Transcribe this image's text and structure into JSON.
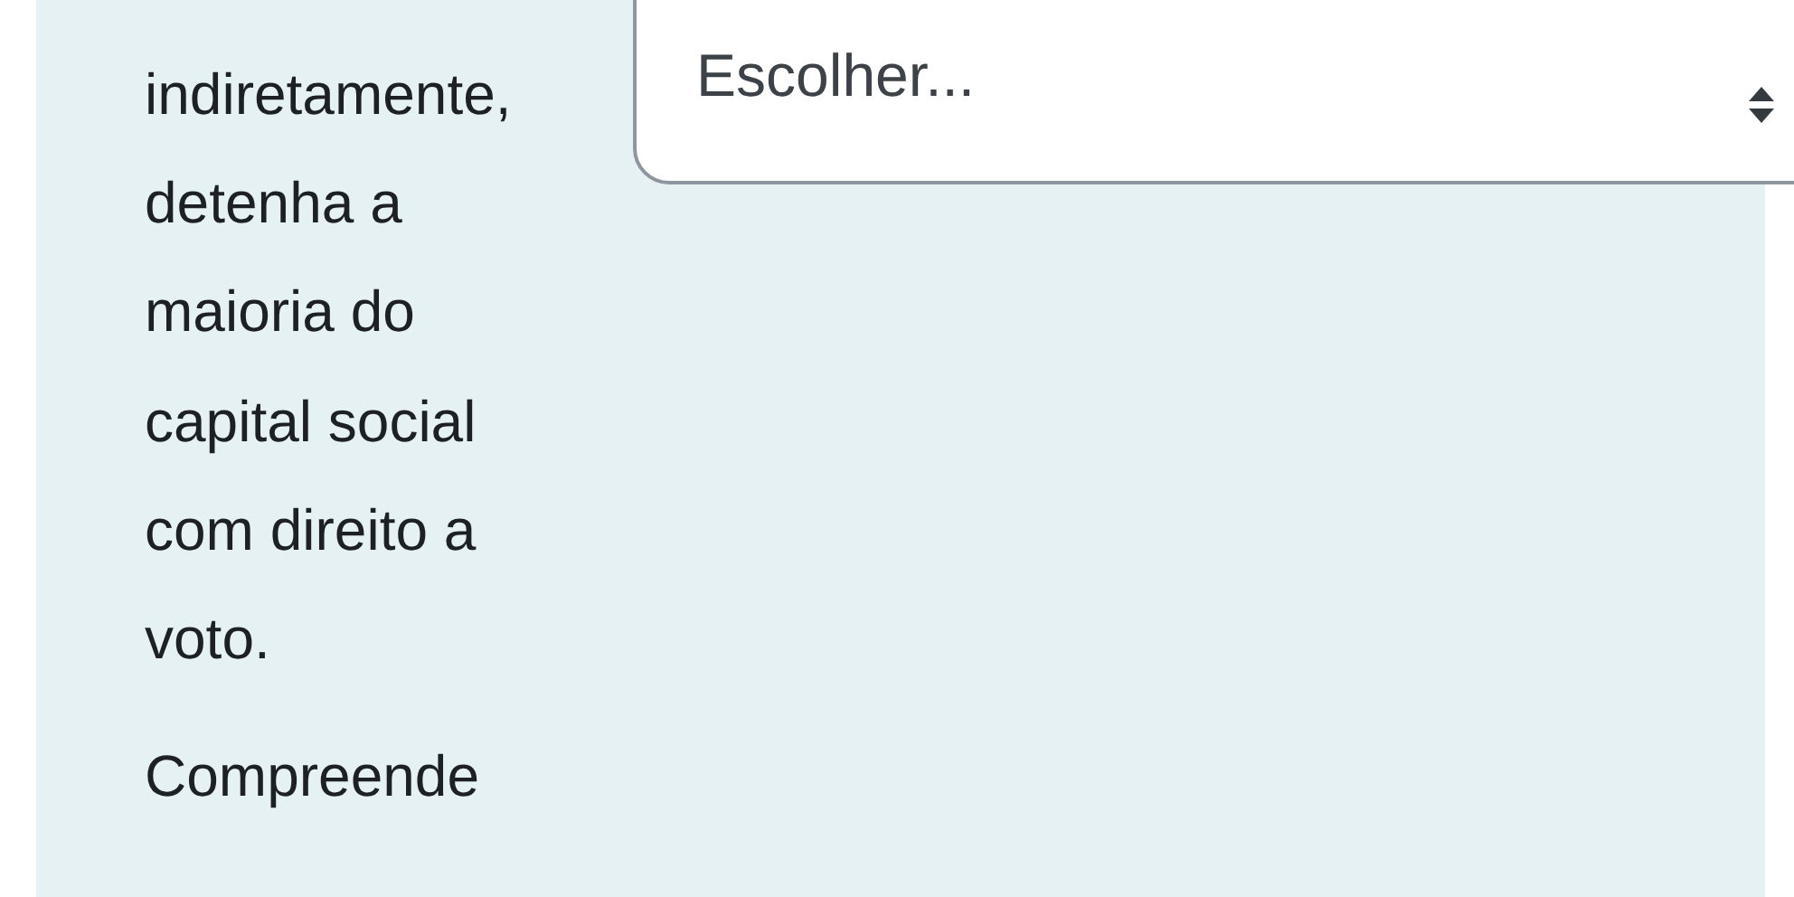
{
  "paragraph_lines": [
    "indiretamente,",
    "detenha a",
    "maioria do",
    "capital social",
    "com direito a",
    "voto."
  ],
  "select": {
    "placeholder": "Escolher..."
  },
  "next_paragraph": "Compreende"
}
